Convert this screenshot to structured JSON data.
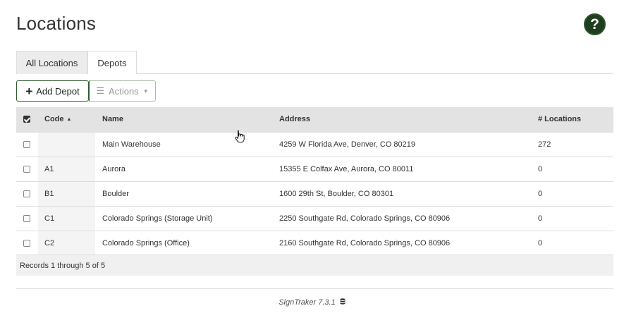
{
  "page": {
    "title": "Locations"
  },
  "help": {
    "label": "?"
  },
  "tabs": [
    {
      "label": "All Locations",
      "active": true
    },
    {
      "label": "Depots",
      "active": false
    }
  ],
  "toolbar": {
    "add_label": "Add Depot",
    "actions_label": "Actions"
  },
  "table": {
    "headers": {
      "code": "Code",
      "name": "Name",
      "address": "Address",
      "locations": "# Locations"
    },
    "sort": {
      "column": "Code",
      "direction": "ascending"
    },
    "rows": [
      {
        "code": "",
        "name": "Main Warehouse",
        "address": "4259 W Florida Ave, Denver, CO 80219",
        "locations": "272"
      },
      {
        "code": "A1",
        "name": "Aurora",
        "address": "15355 E Colfax Ave, Aurora, CO 80011",
        "locations": "0"
      },
      {
        "code": "B1",
        "name": "Boulder",
        "address": "1600 29th St, Boulder, CO 80301",
        "locations": "0"
      },
      {
        "code": "C1",
        "name": "Colorado Springs (Storage Unit)",
        "address": "2250 Southgate Rd, Colorado Springs, CO 80906",
        "locations": "0"
      },
      {
        "code": "C2",
        "name": "Colorado Springs (Office)",
        "address": "2160 Southgate Rd, Colorado Springs, CO 80906",
        "locations": "0"
      }
    ],
    "footer_text": "Records 1 through 5 of 5"
  },
  "footer": {
    "version": "SignTraker 7.3.1"
  },
  "colors": {
    "help_bg": "#1f3d1f",
    "add_border": "#2e5a2e",
    "header_bg": "#e3e3e3"
  },
  "icons": {
    "help": "question-circle-icon",
    "add": "plus-icon",
    "actions": "bars-icon",
    "database": "database-icon"
  }
}
